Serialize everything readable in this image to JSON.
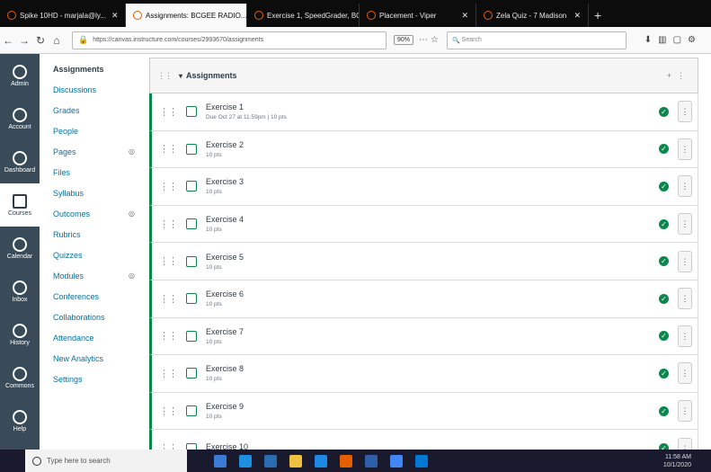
{
  "browser": {
    "tabs": [
      {
        "label": "Spike 10HD - marjala@ly...",
        "active": false
      },
      {
        "label": "Assignments: BCGEE RADIO...",
        "active": true
      },
      {
        "label": "Exercise 1, SpeedGrader, BCG...",
        "active": false
      },
      {
        "label": "Placement - Viper",
        "active": false
      },
      {
        "label": "Zela Quiz - 7 Madison",
        "active": false
      }
    ],
    "new_tab": "+",
    "url": "https://canvas.instructure.com/courses/2993670/assignments",
    "zoom": "90%",
    "search_placeholder": "Search"
  },
  "global_nav": [
    {
      "label": "Admin"
    },
    {
      "label": "Account"
    },
    {
      "label": "Dashboard"
    },
    {
      "label": "Courses",
      "active": true
    },
    {
      "label": "Calendar"
    },
    {
      "label": "Inbox"
    },
    {
      "label": "History"
    },
    {
      "label": "Commons"
    },
    {
      "label": "Help"
    }
  ],
  "course_nav": {
    "items": [
      {
        "label": "Assignments",
        "active": true
      },
      {
        "label": "Discussions"
      },
      {
        "label": "Grades"
      },
      {
        "label": "People"
      },
      {
        "label": "Pages",
        "hidden": true
      },
      {
        "label": "Files"
      },
      {
        "label": "Syllabus"
      },
      {
        "label": "Outcomes",
        "hidden": true
      },
      {
        "label": "Rubrics"
      },
      {
        "label": "Quizzes"
      },
      {
        "label": "Modules",
        "hidden": true
      },
      {
        "label": "Conferences"
      },
      {
        "label": "Collaborations"
      },
      {
        "label": "Attendance"
      },
      {
        "label": "New Analytics"
      },
      {
        "label": "Settings"
      }
    ]
  },
  "group": {
    "title": "Assignments"
  },
  "assignments": [
    {
      "title": "Exercise 1",
      "meta": "Due Oct 27 at 11:59pm  |  10 pts"
    },
    {
      "title": "Exercise 2",
      "meta": "10 pts"
    },
    {
      "title": "Exercise 3",
      "meta": "10 pts"
    },
    {
      "title": "Exercise 4",
      "meta": "10 pts"
    },
    {
      "title": "Exercise 5",
      "meta": "10 pts"
    },
    {
      "title": "Exercise 6",
      "meta": "10 pts"
    },
    {
      "title": "Exercise 7",
      "meta": "10 pts"
    },
    {
      "title": "Exercise 8",
      "meta": "10 pts"
    },
    {
      "title": "Exercise 9",
      "meta": "10 pts"
    },
    {
      "title": "Exercise 10",
      "meta": ""
    }
  ],
  "taskbar": {
    "search_placeholder": "Type here to search",
    "time": "11:58 AM",
    "date": "10/1/2020"
  },
  "colors": {
    "published": "#0b874b",
    "link": "#0770a3",
    "global_nav_bg": "#394b58"
  }
}
